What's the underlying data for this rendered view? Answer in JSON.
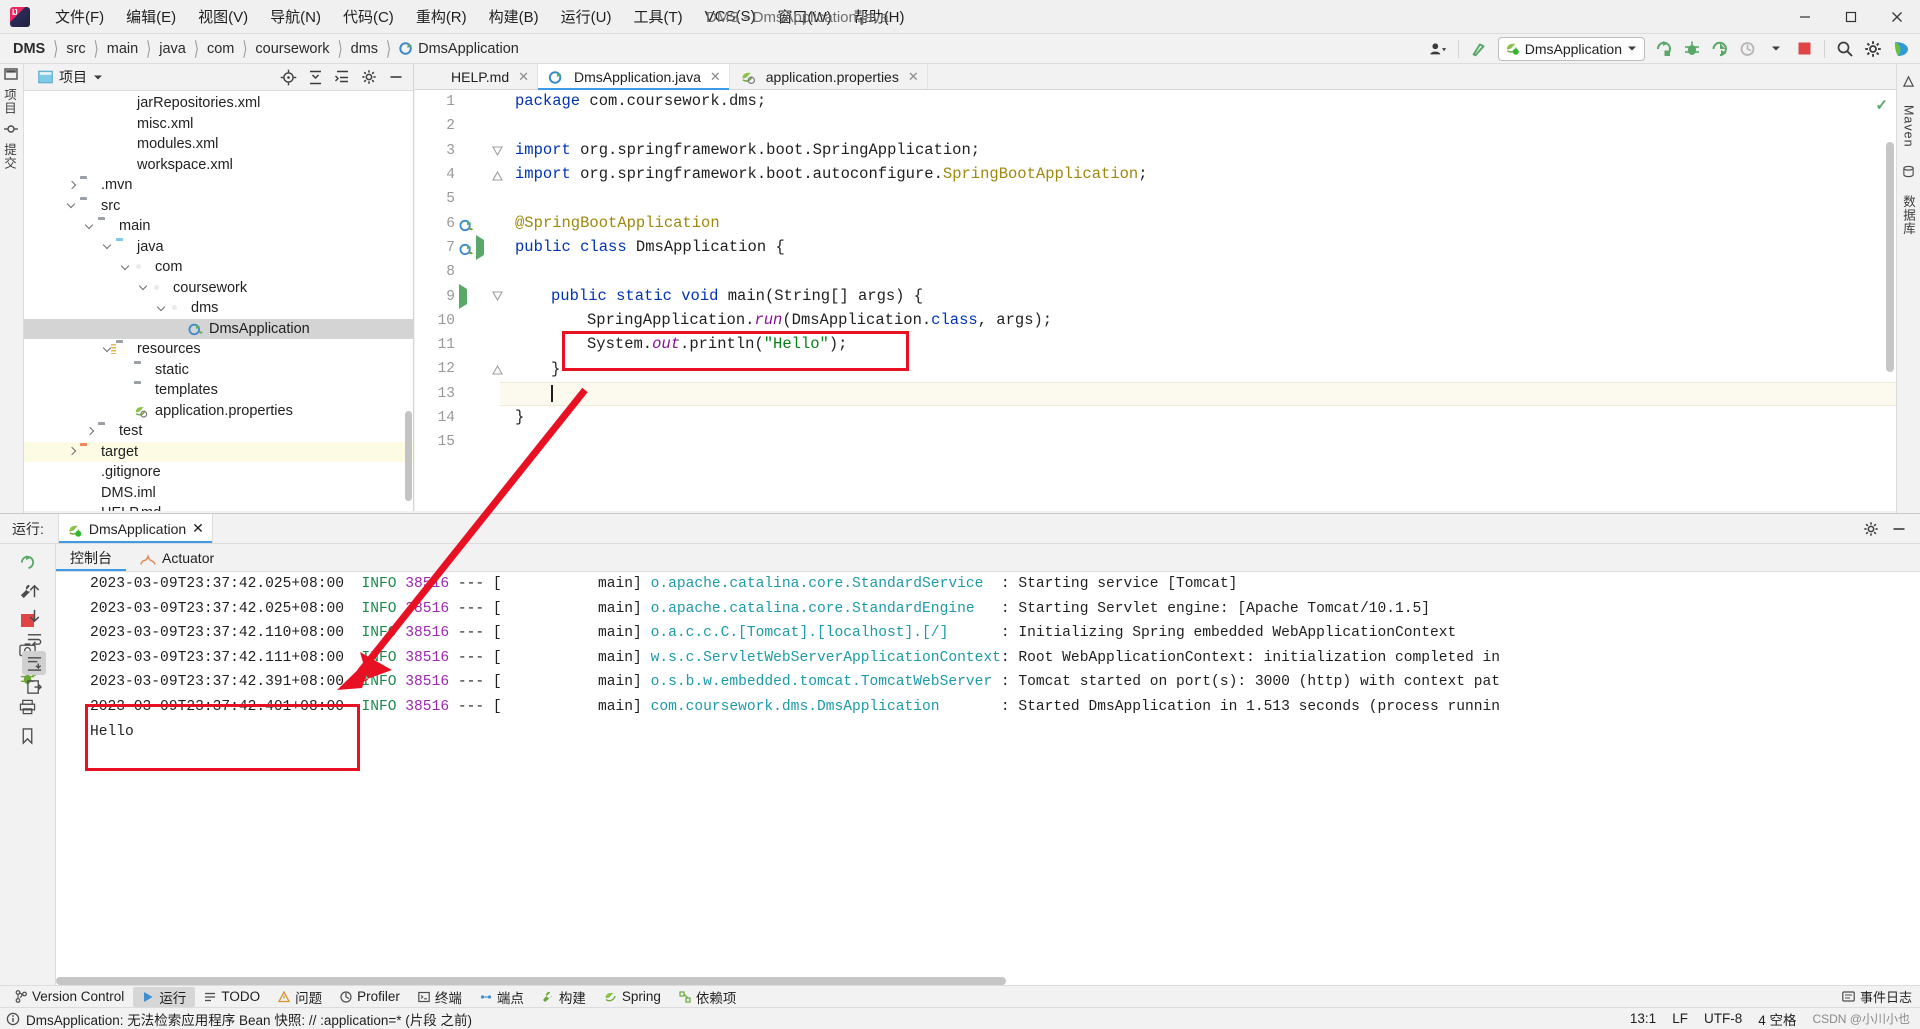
{
  "titlebar": {
    "menus": [
      "文件(F)",
      "编辑(E)",
      "视图(V)",
      "导航(N)",
      "代码(C)",
      "重构(R)",
      "构建(B)",
      "运行(U)",
      "工具(T)",
      "VCS(S)",
      "窗口(W)",
      "帮助(H)"
    ],
    "window_title": "DMS - DmsApplication.java",
    "minimize": "—",
    "maximize": "❐",
    "close": "✕"
  },
  "navbar": {
    "breadcrumbs": [
      "DMS",
      "src",
      "main",
      "java",
      "com",
      "coursework",
      "dms",
      "DmsApplication"
    ],
    "run_config": "DmsApplication",
    "icons": [
      "user-icon",
      "updates-icon",
      "run-icon",
      "debug-icon",
      "run-coverage-icon",
      "profiler-icon",
      "stop-icon",
      "search-icon",
      "settings-icon",
      "ide-assistant-icon"
    ]
  },
  "left_stripe": {
    "labels": [
      "项目",
      "提交"
    ],
    "icons": [
      "project-icon",
      "commit-icon"
    ]
  },
  "right_stripe": {
    "labels": [
      "Maven",
      "数据库"
    ]
  },
  "project_panel": {
    "title": "项目",
    "head_icons": [
      "locate-icon",
      "collapse-all-icon",
      "expand-all-icon",
      "settings-icon",
      "hide-icon"
    ],
    "tree": [
      {
        "label": "jarRepositories.xml",
        "indent": 4,
        "arrow": "none",
        "icon": "xml-file-icon",
        "state": "normal"
      },
      {
        "label": "misc.xml",
        "indent": 4,
        "arrow": "none",
        "icon": "xml-file-icon",
        "state": "normal"
      },
      {
        "label": "modules.xml",
        "indent": 4,
        "arrow": "none",
        "icon": "xml-file-icon",
        "state": "normal"
      },
      {
        "label": "workspace.xml",
        "indent": 4,
        "arrow": "none",
        "icon": "xml-file-icon",
        "state": "normal"
      },
      {
        "label": ".mvn",
        "indent": 2,
        "arrow": "closed",
        "icon": "folder-grey-icon",
        "state": "normal"
      },
      {
        "label": "src",
        "indent": 2,
        "arrow": "open",
        "icon": "folder-grey-icon",
        "state": "normal"
      },
      {
        "label": "main",
        "indent": 3,
        "arrow": "open",
        "icon": "folder-grey-icon",
        "state": "normal"
      },
      {
        "label": "java",
        "indent": 4,
        "arrow": "open",
        "icon": "folder-source-icon",
        "state": "normal"
      },
      {
        "label": "com",
        "indent": 5,
        "arrow": "open",
        "icon": "package-icon",
        "state": "normal"
      },
      {
        "label": "coursework",
        "indent": 6,
        "arrow": "open",
        "icon": "package-icon",
        "state": "normal"
      },
      {
        "label": "dms",
        "indent": 7,
        "arrow": "open",
        "icon": "package-icon",
        "state": "normal"
      },
      {
        "label": "DmsApplication",
        "indent": 8,
        "arrow": "none",
        "icon": "spring-class-icon",
        "state": "selected"
      },
      {
        "label": "resources",
        "indent": 4,
        "arrow": "open",
        "icon": "folder-resources-icon",
        "state": "normal"
      },
      {
        "label": "static",
        "indent": 5,
        "arrow": "none",
        "icon": "folder-grey-icon",
        "state": "normal"
      },
      {
        "label": "templates",
        "indent": 5,
        "arrow": "none",
        "icon": "folder-grey-icon",
        "state": "normal"
      },
      {
        "label": "application.properties",
        "indent": 5,
        "arrow": "none",
        "icon": "spring-properties-icon",
        "state": "normal"
      },
      {
        "label": "test",
        "indent": 3,
        "arrow": "closed",
        "icon": "folder-grey-icon",
        "state": "normal"
      },
      {
        "label": "target",
        "indent": 2,
        "arrow": "closed",
        "icon": "folder-orange-icon",
        "state": "highlight"
      },
      {
        "label": ".gitignore",
        "indent": 2,
        "arrow": "none",
        "icon": "gitignore-file-icon",
        "state": "normal"
      },
      {
        "label": "DMS.iml",
        "indent": 2,
        "arrow": "none",
        "icon": "iml-file-icon",
        "state": "normal"
      },
      {
        "label": "HELP.md",
        "indent": 2,
        "arrow": "none",
        "icon": "md-file-icon",
        "state": "normal"
      }
    ]
  },
  "editor": {
    "tabs": [
      {
        "label": "HELP.md",
        "icon": "md-file-icon",
        "active": false
      },
      {
        "label": "DmsApplication.java",
        "icon": "spring-class-icon",
        "active": true
      },
      {
        "label": "application.properties",
        "icon": "spring-properties-icon",
        "active": false
      }
    ],
    "inspection_status": "✓",
    "caret_line": 13,
    "code_lines": [
      {
        "n": 1,
        "tokens": [
          {
            "t": "package ",
            "c": "k"
          },
          {
            "t": "com.coursework.dms;",
            "c": "plain"
          }
        ],
        "indent": 0,
        "gutter_icons": []
      },
      {
        "n": 2,
        "tokens": [],
        "indent": 0,
        "gutter_icons": []
      },
      {
        "n": 3,
        "tokens": [
          {
            "t": "import ",
            "c": "k"
          },
          {
            "t": "org.springframework.boot.SpringApplication;",
            "c": "plain"
          }
        ],
        "indent": 0,
        "gutter_icons": [],
        "fold": "start"
      },
      {
        "n": 4,
        "tokens": [
          {
            "t": "import ",
            "c": "k"
          },
          {
            "t": "org.springframework.boot.autoconfigure.",
            "c": "plain"
          },
          {
            "t": "SpringBootApplication",
            "c": "ann"
          },
          {
            "t": ";",
            "c": "plain"
          }
        ],
        "indent": 0,
        "gutter_icons": [],
        "fold": "end"
      },
      {
        "n": 5,
        "tokens": [],
        "indent": 0,
        "gutter_icons": []
      },
      {
        "n": 6,
        "tokens": [
          {
            "t": "@SpringBootApplication",
            "c": "ann"
          }
        ],
        "indent": 0,
        "gutter_icons": [
          "spring-bean-icon"
        ]
      },
      {
        "n": 7,
        "tokens": [
          {
            "t": "public class ",
            "c": "k"
          },
          {
            "t": "DmsApplication {",
            "c": "plain"
          }
        ],
        "indent": 0,
        "gutter_icons": [
          "spring-bean-icon",
          "run-icon"
        ]
      },
      {
        "n": 8,
        "tokens": [],
        "indent": 0,
        "gutter_icons": []
      },
      {
        "n": 9,
        "tokens": [
          {
            "t": "public static void ",
            "c": "k"
          },
          {
            "t": "main",
            "c": "plain"
          },
          {
            "t": "(String[] args) {",
            "c": "plain"
          }
        ],
        "indent": 1,
        "gutter_icons": [
          "run-icon"
        ],
        "fold": "start"
      },
      {
        "n": 10,
        "tokens": [
          {
            "t": "SpringApplication.",
            "c": "plain"
          },
          {
            "t": "run",
            "c": "stat"
          },
          {
            "t": "(DmsApplication.",
            "c": "plain"
          },
          {
            "t": "class",
            "c": "k"
          },
          {
            "t": ", args);",
            "c": "plain"
          }
        ],
        "indent": 2,
        "gutter_icons": []
      },
      {
        "n": 11,
        "tokens": [
          {
            "t": "System.",
            "c": "plain"
          },
          {
            "t": "out",
            "c": "stat"
          },
          {
            "t": ".println(",
            "c": "plain"
          },
          {
            "t": "\"Hello\"",
            "c": "str"
          },
          {
            "t": ");",
            "c": "plain"
          }
        ],
        "indent": 2,
        "gutter_icons": []
      },
      {
        "n": 12,
        "tokens": [
          {
            "t": "}",
            "c": "plain"
          }
        ],
        "indent": 1,
        "gutter_icons": [],
        "fold": "end"
      },
      {
        "n": 13,
        "tokens": [],
        "indent": 1,
        "gutter_icons": [],
        "caret": true
      },
      {
        "n": 14,
        "tokens": [
          {
            "t": "}",
            "c": "plain"
          }
        ],
        "indent": 0,
        "gutter_icons": []
      },
      {
        "n": 15,
        "tokens": [],
        "indent": 0,
        "gutter_icons": []
      }
    ]
  },
  "run_panel": {
    "head_label": "运行:",
    "tab_label": "DmsApplication",
    "tab_close": "✕",
    "console_tabs": [
      {
        "label": "控制台",
        "icon": "console-icon",
        "active": true
      },
      {
        "label": "Actuator",
        "icon": "actuator-icon",
        "active": false
      }
    ],
    "head_icons": [
      "settings-icon",
      "hide-icon"
    ],
    "sidebar_icons": [
      "rerun-icon",
      "wrench-icon",
      "stop-icon",
      "camera-icon",
      "thread-dump-icon",
      "print-icon",
      "bookmark-icon",
      "scroll-up-icon",
      "scroll-down-icon",
      "soft-wrap-icon",
      "scroll-end-icon",
      "export-icon"
    ],
    "console_lines": [
      {
        "ts": "2023-03-09T23:37:42.025+08:00",
        "level": "INFO",
        "pid": "38516",
        "dash": "---",
        "thread": "[           main]",
        "logger": "o.apache.catalina.core.StandardService",
        "msg": ": Starting service [Tomcat]"
      },
      {
        "ts": "2023-03-09T23:37:42.025+08:00",
        "level": "INFO",
        "pid": "38516",
        "dash": "---",
        "thread": "[           main]",
        "logger": "o.apache.catalina.core.StandardEngine",
        "msg": ": Starting Servlet engine: [Apache Tomcat/10.1.5]"
      },
      {
        "ts": "2023-03-09T23:37:42.110+08:00",
        "level": "INFO",
        "pid": "38516",
        "dash": "---",
        "thread": "[           main]",
        "logger": "o.a.c.c.C.[Tomcat].[localhost].[/]",
        "msg": ": Initializing Spring embedded WebApplicationContext"
      },
      {
        "ts": "2023-03-09T23:37:42.111+08:00",
        "level": "INFO",
        "pid": "38516",
        "dash": "---",
        "thread": "[           main]",
        "logger": "w.s.c.ServletWebServerApplicationContext",
        "msg": ": Root WebApplicationContext: initialization completed in"
      },
      {
        "ts": "2023-03-09T23:37:42.391+08:00",
        "level": "INFO",
        "pid": "38516",
        "dash": "---",
        "thread": "[           main]",
        "logger": "o.s.b.w.embedded.tomcat.TomcatWebServer",
        "msg": ": Tomcat started on port(s): 3000 (http) with context pat"
      },
      {
        "ts": "2023-03-09T23:37:42.401+08:00",
        "level": "INFO",
        "pid": "38516",
        "dash": "---",
        "thread": "[           main]",
        "logger": "com.coursework.dms.DmsApplication",
        "msg": ": Started DmsApplication in 1.513 seconds (process runnin"
      },
      {
        "out": "Hello"
      }
    ]
  },
  "bottom_strip": {
    "items": [
      {
        "label": "Version Control",
        "icon": "branch-icon",
        "active": false
      },
      {
        "label": "运行",
        "icon": "run-icon",
        "active": true
      },
      {
        "label": "TODO",
        "icon": "todo-icon",
        "active": false
      },
      {
        "label": "问题",
        "icon": "problems-icon",
        "active": false
      },
      {
        "label": "Profiler",
        "icon": "profiler-icon",
        "active": false
      },
      {
        "label": "终端",
        "icon": "terminal-icon",
        "active": false
      },
      {
        "label": "端点",
        "icon": "endpoints-icon",
        "active": false
      },
      {
        "label": "构建",
        "icon": "build-icon",
        "active": false
      },
      {
        "label": "Spring",
        "icon": "spring-icon",
        "active": false
      },
      {
        "label": "依赖项",
        "icon": "dependencies-icon",
        "active": false
      }
    ]
  },
  "statusbar": {
    "message": "DmsApplication: 无法检索应用程序 Bean 快照: // :application=* (片段 之前)",
    "event_log": "事件日志",
    "caret_pos": "13:1",
    "line_sep": "LF",
    "encoding": "UTF-8",
    "indent": "4 空格",
    "watermark": "CSDN @小川小也"
  },
  "colors": {
    "accent_blue": "#3c9ae8",
    "red_annotation": "#e81123",
    "green_run": "#59a869",
    "keyword_blue": "#0033b3",
    "string_green": "#067d17",
    "annotation_gold": "#9e880d",
    "logger_teal": "#1d9aa8",
    "pid_purple": "#9c27b0",
    "selection_grey": "#d4d4d4",
    "highlight_yellow": "#fdfbe4"
  }
}
